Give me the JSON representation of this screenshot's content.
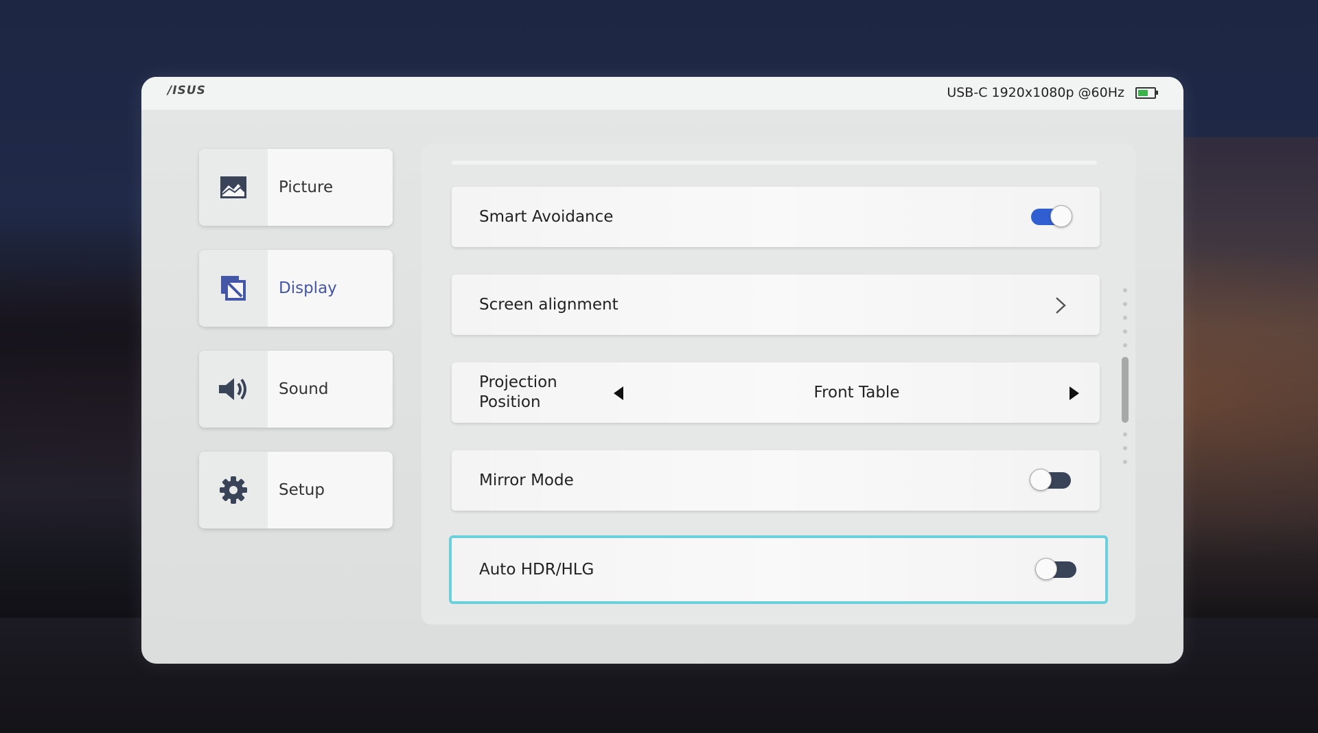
{
  "header": {
    "brand": "/ISUS",
    "status_text": "USB-C  1920x1080p @60Hz",
    "battery_icon": "battery-icon"
  },
  "sidebar": {
    "items": [
      {
        "label": "Picture",
        "icon": "picture-icon",
        "active": false
      },
      {
        "label": "Display",
        "icon": "display-icon",
        "active": true
      },
      {
        "label": "Sound",
        "icon": "speaker-icon",
        "active": false
      },
      {
        "label": "Setup",
        "icon": "gear-icon",
        "active": false
      }
    ]
  },
  "settings": {
    "smart_avoidance": {
      "label": "Smart Avoidance",
      "state": "on"
    },
    "screen_alignment": {
      "label": "Screen alignment"
    },
    "projection_position": {
      "label_line1": "Projection",
      "label_line2": "Position",
      "value": "Front Table"
    },
    "mirror_mode": {
      "label": "Mirror Mode",
      "state": "off"
    },
    "auto_hdr": {
      "label": "Auto HDR/HLG",
      "state": "off"
    }
  },
  "colors": {
    "accent": "#4456a6",
    "toggle_on": "#2f5fd0",
    "toggle_off": "#3a4458",
    "focus_ring": "#6ad0dc",
    "battery_fill": "#3cb34a"
  }
}
